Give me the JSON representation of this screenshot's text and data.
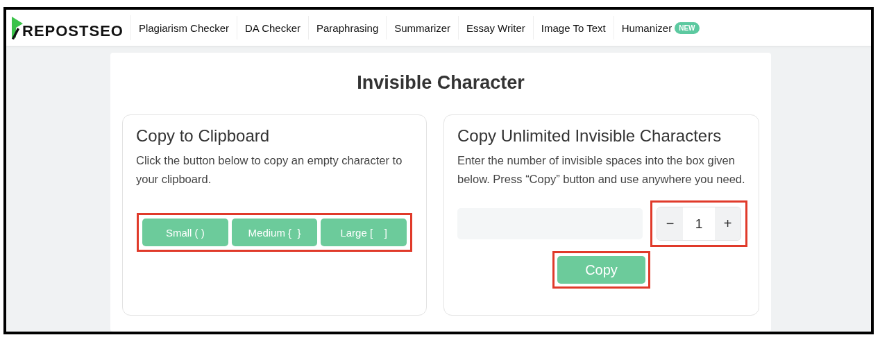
{
  "header": {
    "logo": "REPOSTSEO",
    "nav": [
      {
        "label": "Plagiarism Checker"
      },
      {
        "label": "DA Checker"
      },
      {
        "label": "Paraphrasing"
      },
      {
        "label": "Summarizer"
      },
      {
        "label": "Essay Writer"
      },
      {
        "label": "Image To Text"
      },
      {
        "label": "Humanizer",
        "badge": "NEW"
      }
    ]
  },
  "title": "Invisible Character",
  "left_card": {
    "heading": "Copy to Clipboard",
    "text": "Click the button below to copy an empty character to your clipboard.",
    "buttons_highlighted": true,
    "buttons": [
      "Small ( )",
      "Medium {  }",
      "Large [    ]"
    ]
  },
  "right_card": {
    "heading": "Copy Unlimited Invisible Characters",
    "text": "Enter the number of invisible spaces into the box given below. Press “Copy” button and use anywhere you need.",
    "stepper": {
      "minus": "−",
      "value": "1",
      "plus": "+",
      "highlighted": true
    },
    "copy_button": {
      "label": "Copy",
      "highlighted": true
    }
  }
}
